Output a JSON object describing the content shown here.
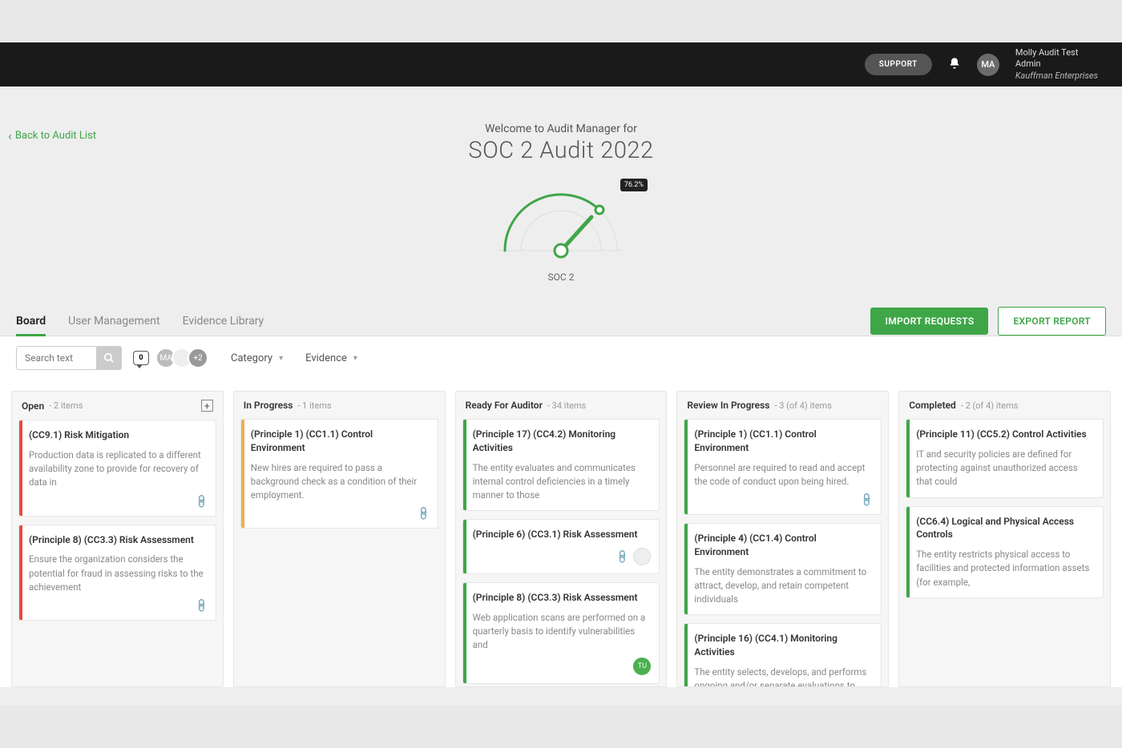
{
  "header": {
    "support_label": "SUPPORT",
    "avatar_initials": "MA",
    "user_name": "Molly Audit Test",
    "user_role": "Admin",
    "org": "Kauffman Enterprises"
  },
  "back_link": "Back to Audit List",
  "welcome": {
    "pre": "Welcome to Audit Manager for",
    "title": "SOC 2 Audit 2022",
    "gauge_percent": "76.2%",
    "gauge_caption": "SOC 2"
  },
  "tabs": [
    "Board",
    "User Management",
    "Evidence Library"
  ],
  "active_tab": 0,
  "actions": {
    "import": "IMPORT REQUESTS",
    "export": "EXPORT REPORT"
  },
  "toolbar": {
    "search_placeholder": "Search text",
    "msg_count": "0",
    "avatar_more": "+2",
    "avatar_initials": "MA",
    "dropdown_category": "Category",
    "dropdown_evidence": "Evidence"
  },
  "columns": [
    {
      "title": "Open",
      "count": "- 2 items",
      "accent": "#e74c3c",
      "show_add": true,
      "cards": [
        {
          "title": "(CC9.1) Risk Mitigation",
          "body": "Production data is replicated to a different availability zone to provide for recovery of data in",
          "attach": true
        },
        {
          "title": "(Principle 8) (CC3.3) Risk Assessment",
          "body": "Ensure the organization considers the potential for fraud in assessing risks to the achievement",
          "attach": true
        }
      ]
    },
    {
      "title": "In Progress",
      "count": "- 1 items",
      "accent": "#f0ad4e",
      "cards": [
        {
          "title": "(Principle 1) (CC1.1) Control Environment",
          "body": "New hires are required to pass a background check as a condition of their employment.",
          "attach": true
        }
      ]
    },
    {
      "title": "Ready For Auditor",
      "count": "- 34 items",
      "accent": "#3fa648",
      "cards": [
        {
          "title": "(Principle 17) (CC4.2) Monitoring Activities",
          "body": "The entity evaluates and communicates internal control deficiencies in a timely manner to those"
        },
        {
          "title": "(Principle 6) (CC3.1) Risk Assessment",
          "body": "",
          "attach": true,
          "blank_avatar": true
        },
        {
          "title": "(Principle 8) (CC3.3) Risk Assessment",
          "body": "Web application scans are performed on a quarterly basis to identify vulnerabilities and",
          "avatar": "TU"
        }
      ]
    },
    {
      "title": "Review In Progress",
      "count": "- 3 (of 4) items",
      "accent": "#3fa648",
      "cards": [
        {
          "title": "(Principle 1) (CC1.1) Control Environment",
          "body": "Personnel are required to read and accept the code of conduct upon being hired.",
          "attach": true
        },
        {
          "title": "(Principle 4) (CC1.4) Control Environment",
          "body": "The entity demonstrates a commitment to attract, develop, and retain competent individuals"
        },
        {
          "title": "(Principle 16) (CC4.1) Monitoring Activities",
          "body": "The entity selects, develops, and performs ongoing and/or separate evaluations to ascertain"
        }
      ]
    },
    {
      "title": "Completed",
      "count": "- 2 (of 4) items",
      "accent": "#3fa648",
      "cards": [
        {
          "title": "(Principle 11) (CC5.2) Control Activities",
          "body": "IT and security policies are defined for protecting against unauthorized access that could"
        },
        {
          "title": "(CC6.4) Logical and Physical Access Controls",
          "body": "The entity restricts physical access to facilities and protected information assets (for example,"
        }
      ]
    }
  ]
}
